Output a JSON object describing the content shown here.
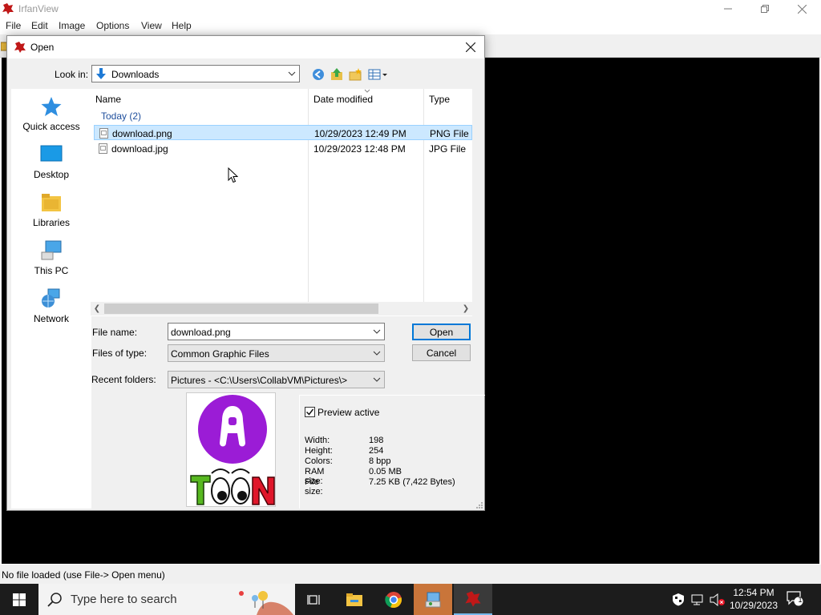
{
  "app": {
    "title": "IrfanView",
    "menu": [
      "File",
      "Edit",
      "Image",
      "Options",
      "View",
      "Help"
    ],
    "status": "No file loaded (use File-> Open menu)"
  },
  "dialog": {
    "title": "Open",
    "look_in_label": "Look in:",
    "look_in_value": "Downloads",
    "places": [
      "Quick access",
      "Desktop",
      "Libraries",
      "This PC",
      "Network"
    ],
    "columns": {
      "name": "Name",
      "date": "Date modified",
      "type": "Type"
    },
    "group": "Today (2)",
    "files": [
      {
        "name": "download.png",
        "date": "10/29/2023 12:49 PM",
        "type": "PNG File",
        "selected": true
      },
      {
        "name": "download.jpg",
        "date": "10/29/2023 12:48 PM",
        "type": "JPG File",
        "selected": false
      }
    ],
    "file_name_label": "File name:",
    "file_name_value": "download.png",
    "files_of_type_label": "Files of type:",
    "files_of_type_value": "Common Graphic Files",
    "recent_folders_label": "Recent folders:",
    "recent_folders_value": "Pictures  -  <C:\\Users\\CollabVM\\Pictures\\>",
    "open_button": "Open",
    "cancel_button": "Cancel",
    "preview_active_label": "Preview active",
    "preview_active_checked": true,
    "preview_logo_text": "TOON",
    "info": [
      {
        "key": "Width:",
        "value": "198"
      },
      {
        "key": "Height:",
        "value": "254"
      },
      {
        "key": "Colors:",
        "value": "8 bpp"
      },
      {
        "key": "RAM size:",
        "value": "0.05 MB"
      },
      {
        "key": "File size:",
        "value": "7.25 KB (7,422 Bytes)"
      }
    ]
  },
  "taskbar": {
    "search_placeholder": "Type here to search",
    "time": "12:54 PM",
    "date": "10/29/2023",
    "notification_count": "1"
  },
  "colors": {
    "selection_bg": "#cce8ff",
    "accent": "#0078d7",
    "taskbar_bg": "#1c1c1c"
  }
}
